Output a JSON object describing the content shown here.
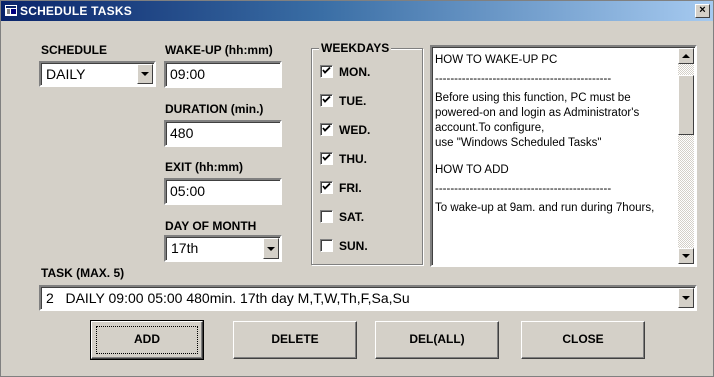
{
  "window": {
    "title": "SCHEDULE TASKS",
    "close_label": "×"
  },
  "schedule": {
    "label": "SCHEDULE",
    "value": "DAILY"
  },
  "wakeup": {
    "label": "WAKE-UP (hh:mm)",
    "value": "09:00"
  },
  "duration": {
    "label": "DURATION (min.)",
    "value": "480"
  },
  "exit": {
    "label": "EXIT (hh:mm)",
    "value": "05:00"
  },
  "day_of_month": {
    "label": "DAY OF MONTH",
    "value": "17th"
  },
  "weekdays": {
    "label": "WEEKDAYS",
    "items": [
      {
        "label": "MON.",
        "checked": true
      },
      {
        "label": "TUE.",
        "checked": true
      },
      {
        "label": "WED.",
        "checked": true
      },
      {
        "label": "THU.",
        "checked": true
      },
      {
        "label": "FRI.",
        "checked": true
      },
      {
        "label": "SAT.",
        "checked": false
      },
      {
        "label": "SUN.",
        "checked": false
      }
    ]
  },
  "help": {
    "lines": [
      "HOW TO WAKE-UP PC",
      "----------------------------------------------",
      "Before using this function, PC must be powered-on and login as Administrator's account.To configure,",
      "use \"Windows Scheduled Tasks\"",
      "HOW TO ADD",
      "----------------------------------------------",
      "To wake-up at 9am. and run during 7hours,"
    ]
  },
  "task": {
    "label": "TASK (MAX. 5)",
    "value": "2   DAILY 09:00 05:00 480min. 17th day M,T,W,Th,F,Sa,Su"
  },
  "buttons": {
    "add": "ADD",
    "delete": "DELETE",
    "del_all": "DEL(ALL)",
    "close": "CLOSE"
  },
  "colors": {
    "face": "#d4d0c8",
    "title_start": "#0a246a",
    "title_end": "#a6caf0"
  }
}
